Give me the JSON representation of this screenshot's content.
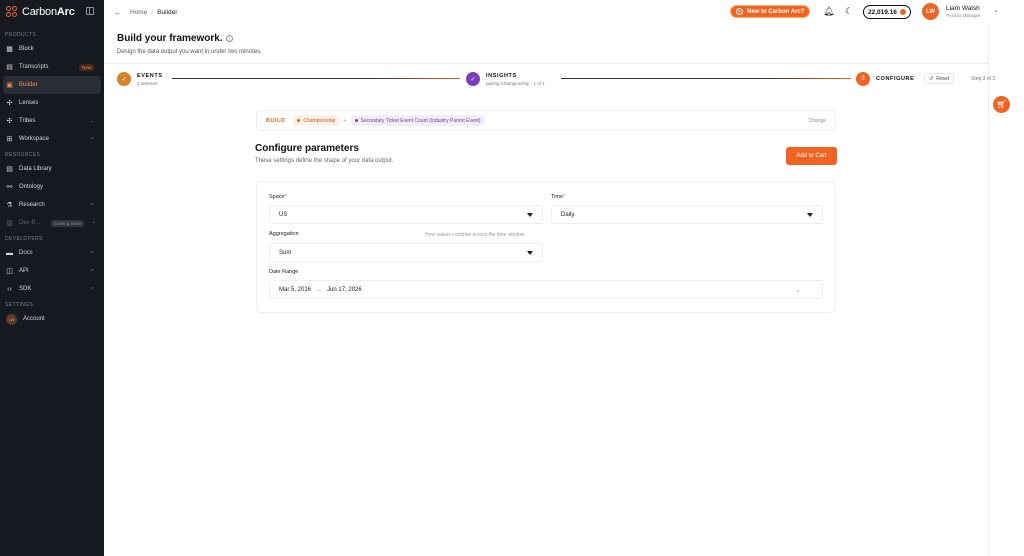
{
  "sidebar": {
    "brand": {
      "name_light": "Carbon",
      "name_bold": "Arc"
    },
    "sections": {
      "products": "PRODUCTS",
      "resources": "RESOURCES",
      "developers": "DEVELOPERS",
      "settings": "SETTINGS"
    },
    "items": {
      "block": "Block",
      "transcripts": "Transcripts",
      "transcripts_badge": "New",
      "builder": "Builder",
      "lenses": "Lenses",
      "tribes": "Tribes",
      "workspace": "Workspace",
      "data_library": "Data Library",
      "ontology": "Ontology",
      "research": "Research",
      "dev_b": "Dev B...",
      "dev_b_badge": "Coming Soon",
      "docs": "Docs",
      "api": "API",
      "sdk": "SDK",
      "account": "Account",
      "account_initials": "LW"
    }
  },
  "header": {
    "breadcrumb_home": "Home",
    "breadcrumb_sep": "/",
    "breadcrumb_current": "Builder",
    "new_button": "New to Carbon Arc?",
    "credits": "22,019.16",
    "user_initials": "LW",
    "user_name": "Liam Walsh",
    "user_role": "Product Manager"
  },
  "page": {
    "title": "Build your framework.",
    "subtitle": "Design the data output you want in under two minutes."
  },
  "stepper": {
    "steps": [
      {
        "title": "EVENTS",
        "sub": "3 selected"
      },
      {
        "title": "INSIGHTS",
        "sub": "pairing Championship · 1 of 1"
      },
      {
        "title": "CONFIGURE",
        "number": "3"
      }
    ],
    "reset": "Reset",
    "counter": "Step 3 of 3"
  },
  "build": {
    "label": "BUILD",
    "chip1": "Championship",
    "plus": "+",
    "chip2": "Secondary Ticket Event Count (Industry Parent Event)",
    "change": "Change"
  },
  "configure": {
    "title": "Configure parameters",
    "subtitle": "These settings define the shape of your data output.",
    "add_to_cart": "Add to Cart",
    "space_label": "Space",
    "space_value": "US",
    "time_label": "Time",
    "time_value": "Daily",
    "aggregation_label": "Aggregation",
    "aggregation_hint": "How values combine across the time window",
    "aggregation_value": "Sum",
    "date_range_label": "Date Range",
    "date_start": "Mar 5, 2016",
    "date_arrow": "→",
    "date_end": "Jun 17, 2026",
    "required_mark": "*"
  },
  "colors": {
    "accent": "#f06322",
    "sidebar_bg": "#16191f",
    "insights_purple": "#7a3fb8",
    "events_orange": "#d9822b"
  }
}
